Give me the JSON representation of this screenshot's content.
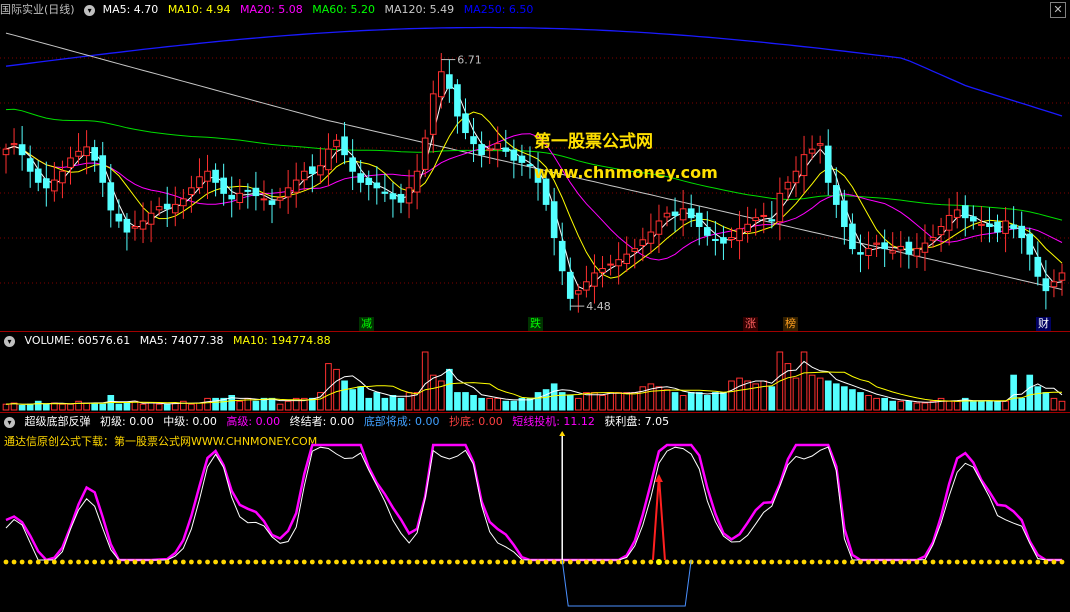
{
  "main": {
    "stock_name": "国际实业(日线)",
    "legend": [
      {
        "label": "MA5: 4.70",
        "color": "#ffffff"
      },
      {
        "label": "MA10: 4.94",
        "color": "#ffff00"
      },
      {
        "label": "MA20: 5.08",
        "color": "#ff00ff"
      },
      {
        "label": "MA60: 5.20",
        "color": "#00ff00"
      },
      {
        "label": "MA120: 5.49",
        "color": "#c8c8c8"
      },
      {
        "label": "MA250: 6.50",
        "color": "#0000ff"
      }
    ],
    "high_label": "6.71",
    "low_label": "4.48",
    "watermark_title": "第一股票公式网",
    "watermark_url": "www.chnmoney.com",
    "signals": [
      {
        "text": "减",
        "color": "#00ff00",
        "bg": "#003300"
      },
      {
        "text": "跌",
        "color": "#00ff00",
        "bg": "#003300"
      },
      {
        "text": "涨",
        "color": "#ff6060",
        "bg": "#330000"
      },
      {
        "text": "榜",
        "color": "#ffa020",
        "bg": "#332000"
      },
      {
        "text": "财",
        "color": "#ffffff",
        "bg": "#000060"
      }
    ]
  },
  "volume": {
    "legend": [
      {
        "label": "VOLUME: 60576.61",
        "color": "#ffffff"
      },
      {
        "label": "MA5: 74077.38",
        "color": "#ffffff"
      },
      {
        "label": "MA10: 194774.88",
        "color": "#ffff00"
      }
    ]
  },
  "indicator": {
    "legend": [
      {
        "label": "超级底部反弹",
        "color": "#ffffff"
      },
      {
        "label": "初级: 0.00",
        "color": "#ffffff"
      },
      {
        "label": "中级: 0.00",
        "color": "#ffffff"
      },
      {
        "label": "高级: 0.00",
        "color": "#ff00ff"
      },
      {
        "label": "终结者: 0.00",
        "color": "#ffffff"
      },
      {
        "label": "底部将成: 0.00",
        "color": "#40a0ff"
      },
      {
        "label": "抄底: 0.00",
        "color": "#ff4040"
      },
      {
        "label": "短线投机: 11.12",
        "color": "#ff00ff"
      },
      {
        "label": "获利盘: 7.05",
        "color": "#ffffff"
      }
    ],
    "promo": "通达信原创公式下载：第一股票公式网WWW.CHNMONEY.COM"
  },
  "chart_data": [
    {
      "type": "candlestick",
      "title": "国际实业(日线)",
      "high_marker": 6.71,
      "low_marker": 4.48,
      "series": [
        {
          "name": "MA5",
          "last": 4.7
        },
        {
          "name": "MA10",
          "last": 4.94
        },
        {
          "name": "MA20",
          "last": 5.08
        },
        {
          "name": "MA60",
          "last": 5.2
        },
        {
          "name": "MA120",
          "last": 5.49
        },
        {
          "name": "MA250",
          "last": 6.5
        }
      ],
      "close": [
        5.9,
        5.95,
        5.85,
        5.7,
        5.6,
        5.55,
        5.62,
        5.7,
        5.82,
        5.88,
        5.92,
        5.8,
        5.6,
        5.35,
        5.25,
        5.15,
        5.2,
        5.25,
        5.32,
        5.38,
        5.36,
        5.4,
        5.45,
        5.55,
        5.65,
        5.7,
        5.6,
        5.5,
        5.45,
        5.5,
        5.52,
        5.48,
        5.45,
        5.4,
        5.46,
        5.55,
        5.62,
        5.7,
        5.68,
        5.75,
        5.9,
        5.98,
        5.85,
        5.7,
        5.6,
        5.58,
        5.55,
        5.5,
        5.45,
        5.42,
        5.55,
        5.7,
        6.0,
        6.4,
        6.6,
        6.45,
        6.2,
        6.05,
        5.95,
        5.85,
        5.9,
        5.95,
        5.88,
        5.8,
        5.78,
        5.75,
        5.6,
        5.4,
        5.1,
        4.8,
        4.55,
        4.62,
        4.7,
        4.78,
        4.82,
        4.86,
        4.9,
        4.95,
        5.0,
        5.08,
        5.15,
        5.25,
        5.32,
        5.3,
        5.36,
        5.28,
        5.2,
        5.12,
        5.08,
        5.05,
        5.1,
        5.18,
        5.22,
        5.28,
        5.3,
        5.25,
        5.5,
        5.6,
        5.7,
        5.85,
        5.9,
        5.95,
        5.6,
        5.4,
        5.2,
        5.0,
        4.95,
        5.0,
        5.05,
        5.0,
        4.98,
        5.02,
        4.95,
        5.0,
        5.05,
        5.1,
        5.2,
        5.3,
        5.35,
        5.28,
        5.25,
        5.22,
        5.2,
        5.15,
        5.25,
        5.18,
        5.1,
        4.95,
        4.75,
        4.62,
        4.7,
        4.78
      ]
    },
    {
      "type": "bar",
      "title": "VOLUME",
      "series": [
        {
          "name": "VOLUME",
          "last": 60576.61
        },
        {
          "name": "MA5",
          "last": 74077.38
        },
        {
          "name": "MA10",
          "last": 194774.88
        }
      ],
      "values": [
        0.1,
        0.12,
        0.08,
        0.1,
        0.15,
        0.1,
        0.12,
        0.1,
        0.1,
        0.15,
        0.12,
        0.12,
        0.1,
        0.25,
        0.1,
        0.12,
        0.15,
        0.1,
        0.12,
        0.1,
        0.1,
        0.12,
        0.15,
        0.1,
        0.12,
        0.2,
        0.2,
        0.2,
        0.25,
        0.15,
        0.2,
        0.15,
        0.2,
        0.2,
        0.1,
        0.15,
        0.2,
        0.2,
        0.2,
        0.3,
        0.8,
        0.7,
        0.5,
        0.35,
        0.4,
        0.2,
        0.3,
        0.2,
        0.25,
        0.2,
        0.3,
        0.3,
        1.0,
        0.6,
        0.5,
        0.7,
        0.3,
        0.3,
        0.25,
        0.2,
        0.2,
        0.2,
        0.15,
        0.15,
        0.2,
        0.2,
        0.3,
        0.35,
        0.45,
        0.3,
        0.25,
        0.2,
        0.3,
        0.3,
        0.25,
        0.3,
        0.3,
        0.3,
        0.3,
        0.4,
        0.45,
        0.4,
        0.35,
        0.3,
        0.25,
        0.3,
        0.3,
        0.25,
        0.3,
        0.3,
        0.5,
        0.55,
        0.5,
        0.45,
        0.5,
        0.4,
        1.0,
        0.8,
        0.55,
        1.0,
        0.6,
        0.55,
        0.5,
        0.45,
        0.4,
        0.35,
        0.3,
        0.25,
        0.2,
        0.2,
        0.15,
        0.15,
        0.15,
        0.12,
        0.12,
        0.15,
        0.2,
        0.15,
        0.15,
        0.2,
        0.15,
        0.15,
        0.15,
        0.15,
        0.15,
        0.6,
        0.2,
        0.6,
        0.4,
        0.3,
        0.2,
        0.15
      ]
    },
    {
      "type": "line",
      "title": "超级底部反弹",
      "series": [
        {
          "name": "短线投机",
          "last": 11.12
        },
        {
          "name": "获利盘",
          "last": 7.05
        },
        {
          "name": "初级",
          "last": 0.0
        },
        {
          "name": "中级",
          "last": 0.0
        },
        {
          "name": "高级",
          "last": 0.0
        },
        {
          "name": "终结者",
          "last": 0.0
        },
        {
          "name": "底部将成",
          "last": 0.0
        },
        {
          "name": "抄底",
          "last": 0.0
        }
      ]
    }
  ]
}
